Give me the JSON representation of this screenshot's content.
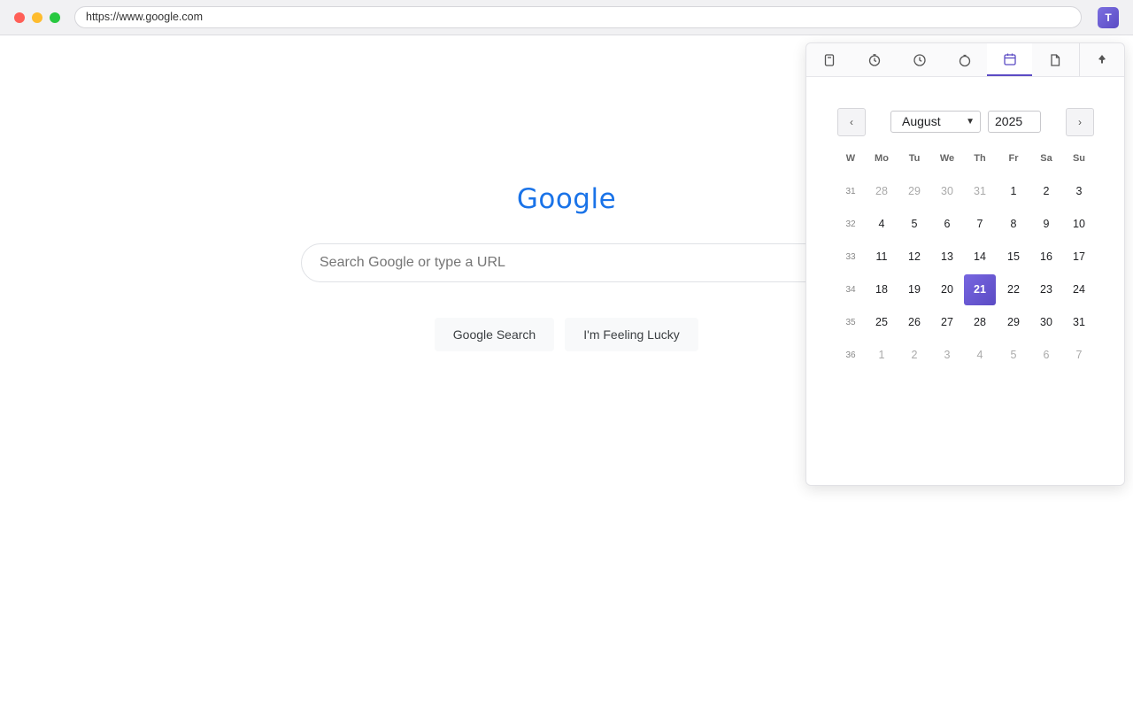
{
  "browser": {
    "url": "https://www.google.com",
    "extension_initial": "T"
  },
  "google": {
    "logo": "Google",
    "search_placeholder": "Search Google or type a URL",
    "search_button": "Google Search",
    "lucky_button": "I'm Feeling Lucky"
  },
  "panel": {
    "tabs": [
      {
        "icon": "notes-icon"
      },
      {
        "icon": "timer-icon"
      },
      {
        "icon": "clock-icon"
      },
      {
        "icon": "stopwatch-icon"
      },
      {
        "icon": "calendar-icon",
        "active": true
      },
      {
        "icon": "document-icon"
      },
      {
        "icon": "pin-icon"
      }
    ],
    "accent_color": "#5b4bc4",
    "prev_label": "‹",
    "next_label": "›",
    "month": "August",
    "year": "2025",
    "headers": [
      "W",
      "Mo",
      "Tu",
      "We",
      "Th",
      "Fr",
      "Sa",
      "Su"
    ],
    "weeks": [
      {
        "week": "31",
        "days": [
          [
            "28",
            1
          ],
          [
            "29",
            1
          ],
          [
            "30",
            1
          ],
          [
            "31",
            1
          ],
          [
            "1",
            0
          ],
          [
            "2",
            0
          ],
          [
            "3",
            0
          ]
        ]
      },
      {
        "week": "32",
        "days": [
          [
            "4",
            0
          ],
          [
            "5",
            0
          ],
          [
            "6",
            0
          ],
          [
            "7",
            0
          ],
          [
            "8",
            0
          ],
          [
            "9",
            0
          ],
          [
            "10",
            0
          ]
        ]
      },
      {
        "week": "33",
        "days": [
          [
            "11",
            0
          ],
          [
            "12",
            0
          ],
          [
            "13",
            0
          ],
          [
            "14",
            0
          ],
          [
            "15",
            0
          ],
          [
            "16",
            0
          ],
          [
            "17",
            0
          ]
        ]
      },
      {
        "week": "34",
        "days": [
          [
            "18",
            0
          ],
          [
            "19",
            0
          ],
          [
            "20",
            0
          ],
          [
            "21",
            2
          ],
          [
            "22",
            0
          ],
          [
            "23",
            0
          ],
          [
            "24",
            0
          ]
        ]
      },
      {
        "week": "35",
        "days": [
          [
            "25",
            0
          ],
          [
            "26",
            0
          ],
          [
            "27",
            0
          ],
          [
            "28",
            0
          ],
          [
            "29",
            0
          ],
          [
            "30",
            0
          ],
          [
            "31",
            0
          ]
        ]
      },
      {
        "week": "36",
        "days": [
          [
            "1",
            1
          ],
          [
            "2",
            1
          ],
          [
            "3",
            1
          ],
          [
            "4",
            1
          ],
          [
            "5",
            1
          ],
          [
            "6",
            1
          ],
          [
            "7",
            1
          ]
        ]
      }
    ]
  }
}
